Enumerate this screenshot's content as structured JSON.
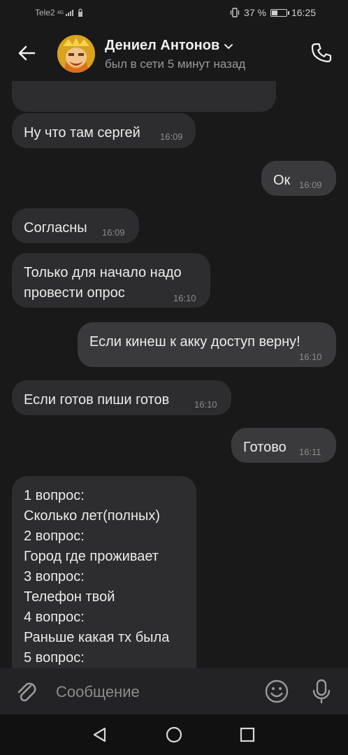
{
  "status_bar": {
    "carrier": "Tele2",
    "network": "4G",
    "battery_text": "37 %",
    "battery_level": 0.37,
    "time": "16:25"
  },
  "header": {
    "contact_name": "Дениел Антонов",
    "contact_status": "был в сети 5 минут назад",
    "icons": [
      "arrow-left-icon",
      "chevron-down-icon",
      "phone-icon"
    ]
  },
  "messages": [
    {
      "direction": "in",
      "text": "",
      "time": "16:09"
    },
    {
      "direction": "in",
      "text": "Ну что там сергей",
      "time": "16:09"
    },
    {
      "direction": "out",
      "text": "Ок",
      "time": "16:09"
    },
    {
      "direction": "in",
      "text": "Согласны",
      "time": "16:09"
    },
    {
      "direction": "in",
      "text": "Только для начало надо\nпровести опрос",
      "time": "16:10"
    },
    {
      "direction": "out",
      "text": "Если кинеш к акку доступ верну!",
      "time": "16:10"
    },
    {
      "direction": "in",
      "text": "Если готов пиши готов",
      "time": "16:10"
    },
    {
      "direction": "out",
      "text": "Готово",
      "time": "16:11"
    },
    {
      "direction": "in",
      "text": "1 вопрос:\nСколько лет(полных)\n2 вопрос:\nГород где проживает\n3 вопрос:\nТелефон твой\n4 вопрос:\nРаньше какая тх была\n5 вопрос:",
      "time": ""
    }
  ],
  "composer": {
    "placeholder": "Сообщение",
    "icons": [
      "paperclip-icon",
      "smiley-icon",
      "microphone-icon"
    ]
  },
  "nav": {
    "icons": [
      "back-triangle-icon",
      "home-circle-icon",
      "recents-square-icon"
    ]
  },
  "colors": {
    "background": "#19191a",
    "incoming_bubble": "#2d2d2f",
    "outgoing_bubble": "#3a3a3c",
    "text": "#ececec",
    "muted": "#8b8b8b"
  }
}
